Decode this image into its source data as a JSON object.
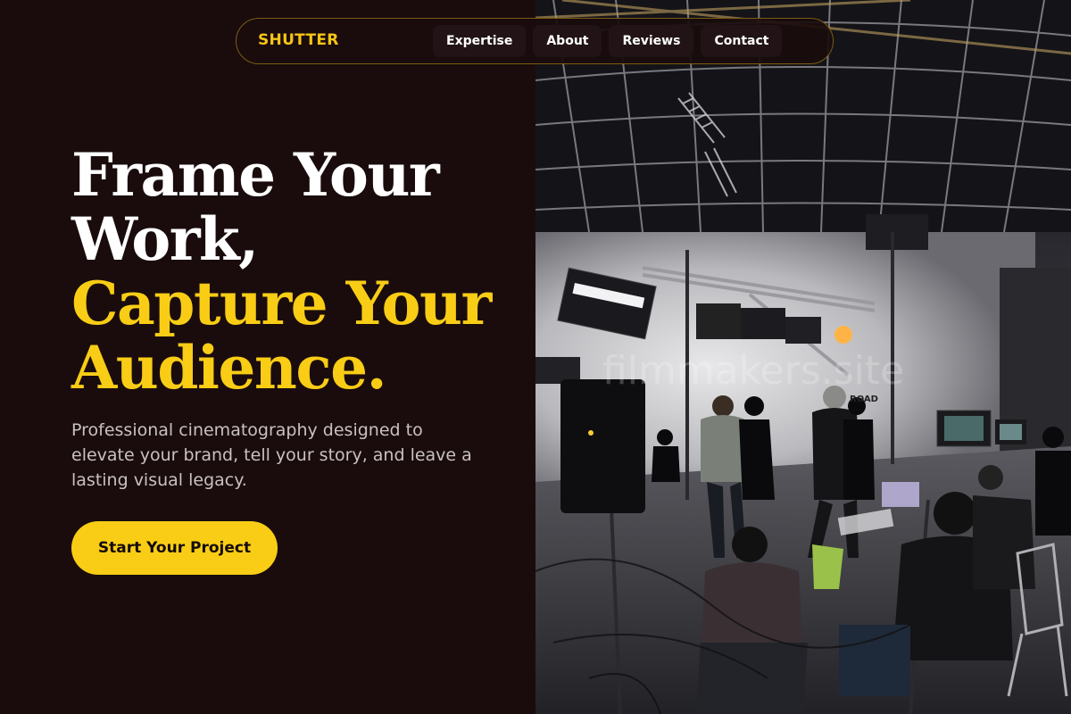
{
  "nav": {
    "brand": "SHUTTER",
    "links": [
      {
        "label": "Expertise"
      },
      {
        "label": "About"
      },
      {
        "label": "Reviews"
      },
      {
        "label": "Contact"
      }
    ]
  },
  "hero": {
    "headline_line1": "Frame Your",
    "headline_line2": "Work,",
    "headline_line3": "Capture Your",
    "headline_line4": "Audience.",
    "subtitle": "Professional cinematography designed to elevate your brand, tell your story, and leave a lasting visual legacy.",
    "cta_label": "Start Your Project",
    "image_watermark": "filmmakers.site",
    "image_sign": "ROAD"
  },
  "colors": {
    "background": "#1a0c0d",
    "accent": "#f9cd15",
    "text": "#ffffff",
    "muted_text": "#c9c1c1",
    "nav_border": "#7a5c13"
  }
}
